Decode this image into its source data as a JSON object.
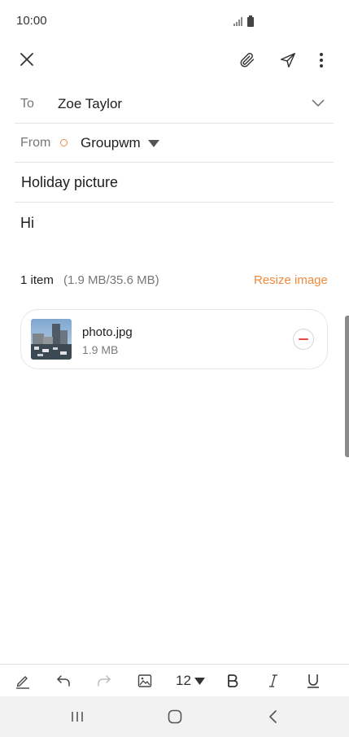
{
  "status_bar": {
    "time": "10:00"
  },
  "compose": {
    "to_label": "To",
    "to_value": "Zoe Taylor",
    "from_label": "From",
    "from_value": "Groupwm",
    "subject": "Holiday picture",
    "body": "Hi"
  },
  "attachments": {
    "count_text": "1 item",
    "size_text": "(1.9 MB/35.6 MB)",
    "resize_label": "Resize image",
    "items": [
      {
        "name": "photo.jpg",
        "size": "1.9 MB"
      }
    ]
  },
  "toolbar": {
    "font_size": "12"
  },
  "colors": {
    "accent": "#f08a3c",
    "remove": "#e24a4a",
    "divider": "#e3e3e3"
  }
}
